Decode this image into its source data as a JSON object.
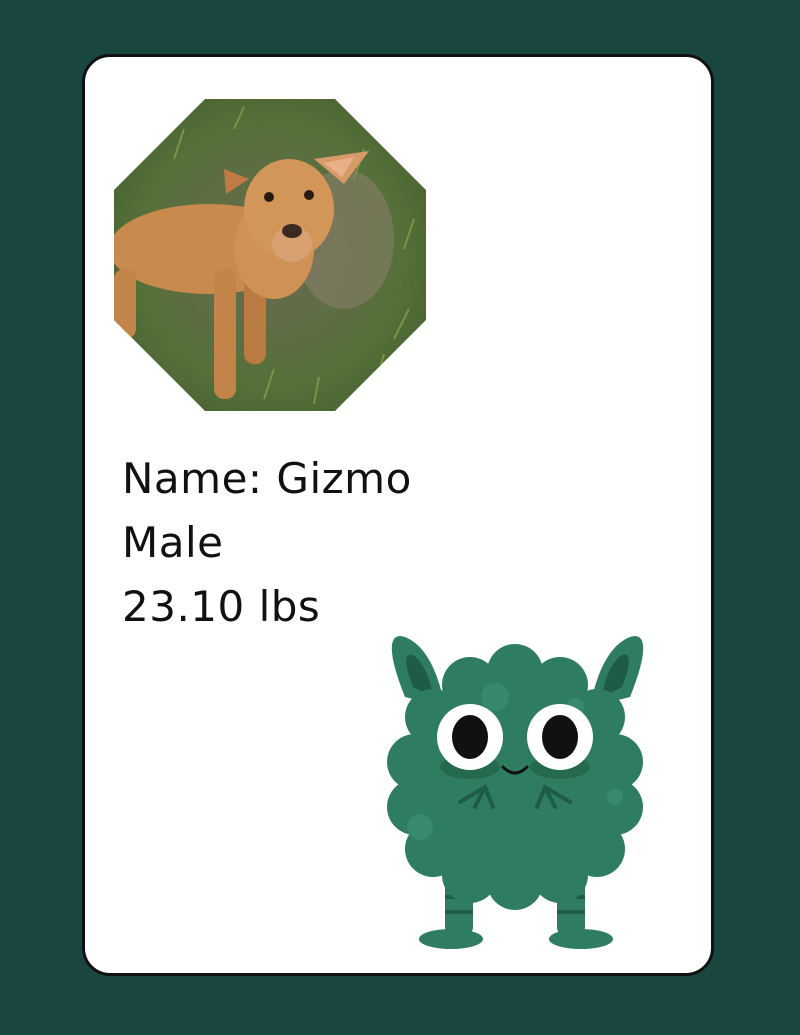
{
  "pet_card": {
    "name_line": "Name: Gizmo",
    "sex": "Male",
    "weight": "23.10 lbs"
  },
  "colors": {
    "background": "#1a4640",
    "card": "#ffffff",
    "monster_body": "#2f7d60",
    "monster_dark": "#1f5c45",
    "text": "#111111"
  },
  "icons": {
    "photo": "dog-photo",
    "mascot": "green-monster-illustration"
  }
}
